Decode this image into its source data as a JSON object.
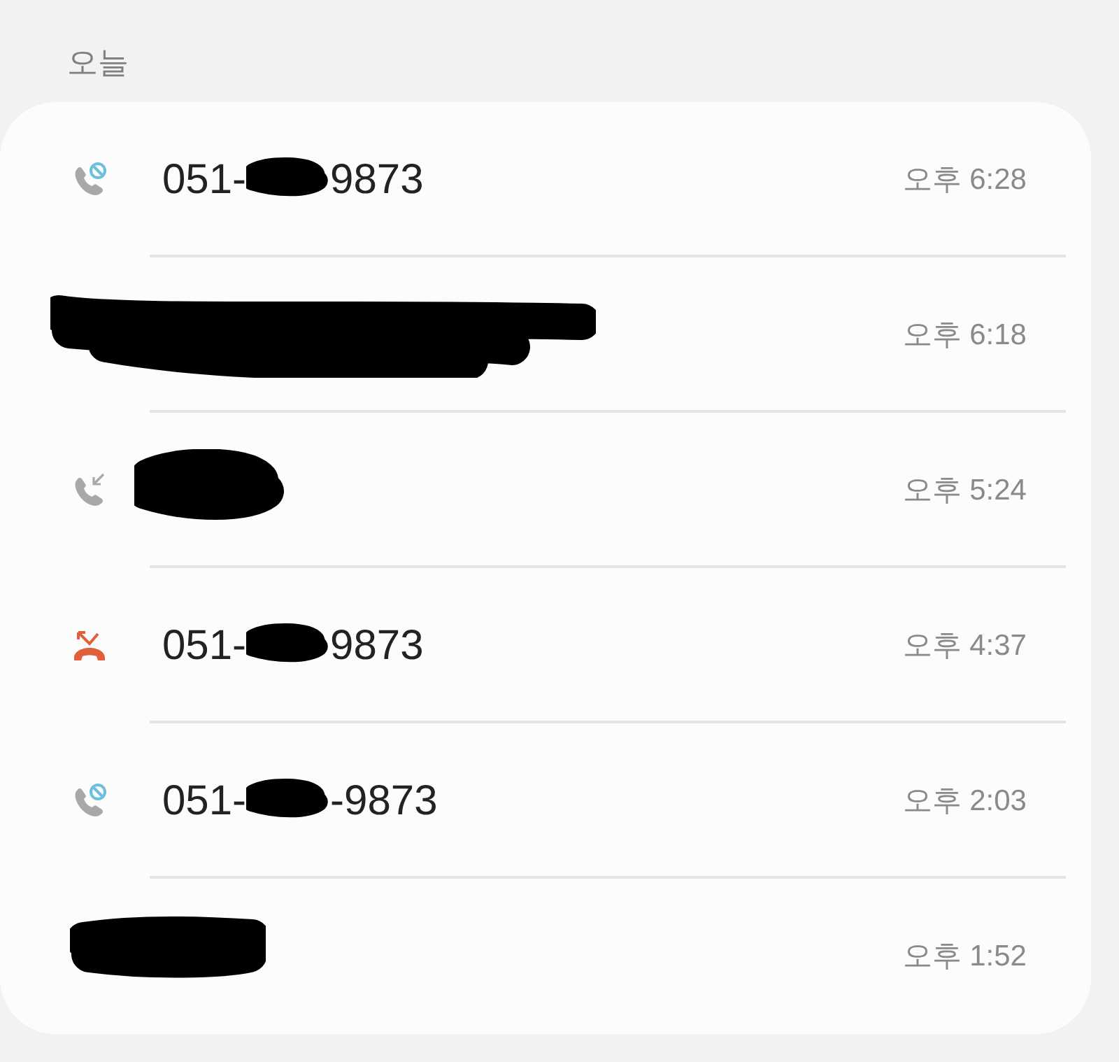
{
  "section_title": "오늘",
  "calls": [
    {
      "kind": "blocked",
      "number": [
        "051-",
        "9873"
      ],
      "time": "오후 6:28"
    },
    {
      "time": "오후 6:18"
    },
    {
      "kind": "incoming",
      "time": "오후 5:24"
    },
    {
      "kind": "rejected",
      "number": [
        "051-",
        "9873"
      ],
      "time": "오후 4:37"
    },
    {
      "kind": "blocked",
      "number": [
        "051-",
        "-9873"
      ],
      "time": "오후 2:03"
    },
    {
      "time": "오후 1:52"
    }
  ]
}
